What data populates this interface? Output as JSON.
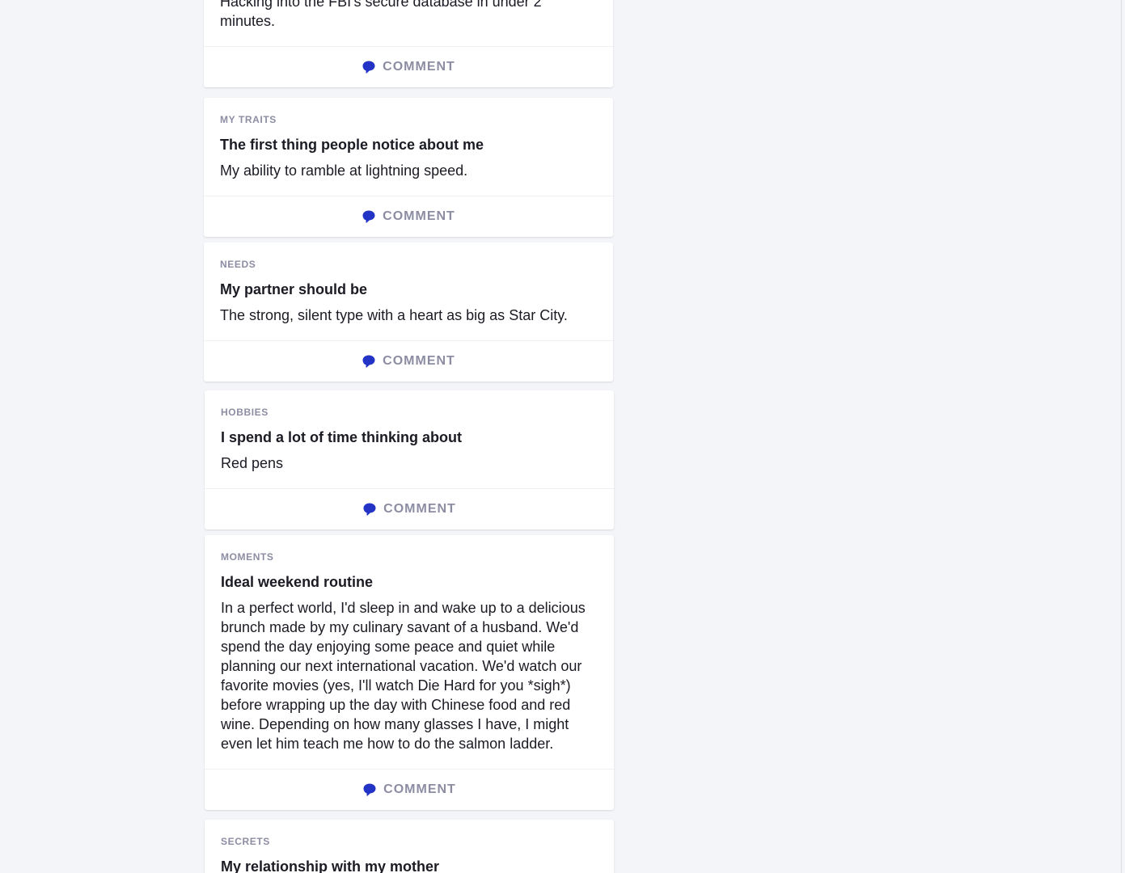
{
  "comment_label": "COMMENT",
  "colors": {
    "accent": "#2233c5",
    "muted": "#8c8da3",
    "text": "#1b1b24",
    "background": "#f4f5f8"
  },
  "cards": [
    {
      "category": "",
      "prompt": "",
      "answer": "Hacking into the FBI's secure database in under 2 minutes."
    },
    {
      "category": "MY TRAITS",
      "prompt": "The first thing people notice about me",
      "answer": "My ability to ramble at lightning speed."
    },
    {
      "category": "NEEDS",
      "prompt": "My partner should be",
      "answer": "The strong, silent type with a heart as big as Star City."
    },
    {
      "category": "HOBBIES",
      "prompt": "I spend a lot of time thinking about",
      "answer": "Red pens"
    },
    {
      "category": "MOMENTS",
      "prompt": "Ideal weekend routine",
      "answer": "In a perfect world, I'd sleep in and wake up to a delicious brunch made by my culinary savant of a husband. We'd spend the day enjoying some peace and quiet while planning our next international vacation. We'd watch our favorite movies (yes, I'll watch Die Hard for you *sigh*) before wrapping up the day with Chinese food and red wine. Depending on how many glasses I have, I might even let him teach me how to do the salmon ladder."
    },
    {
      "category": "SECRETS",
      "prompt": "My relationship with my mother",
      "answer": ""
    }
  ]
}
